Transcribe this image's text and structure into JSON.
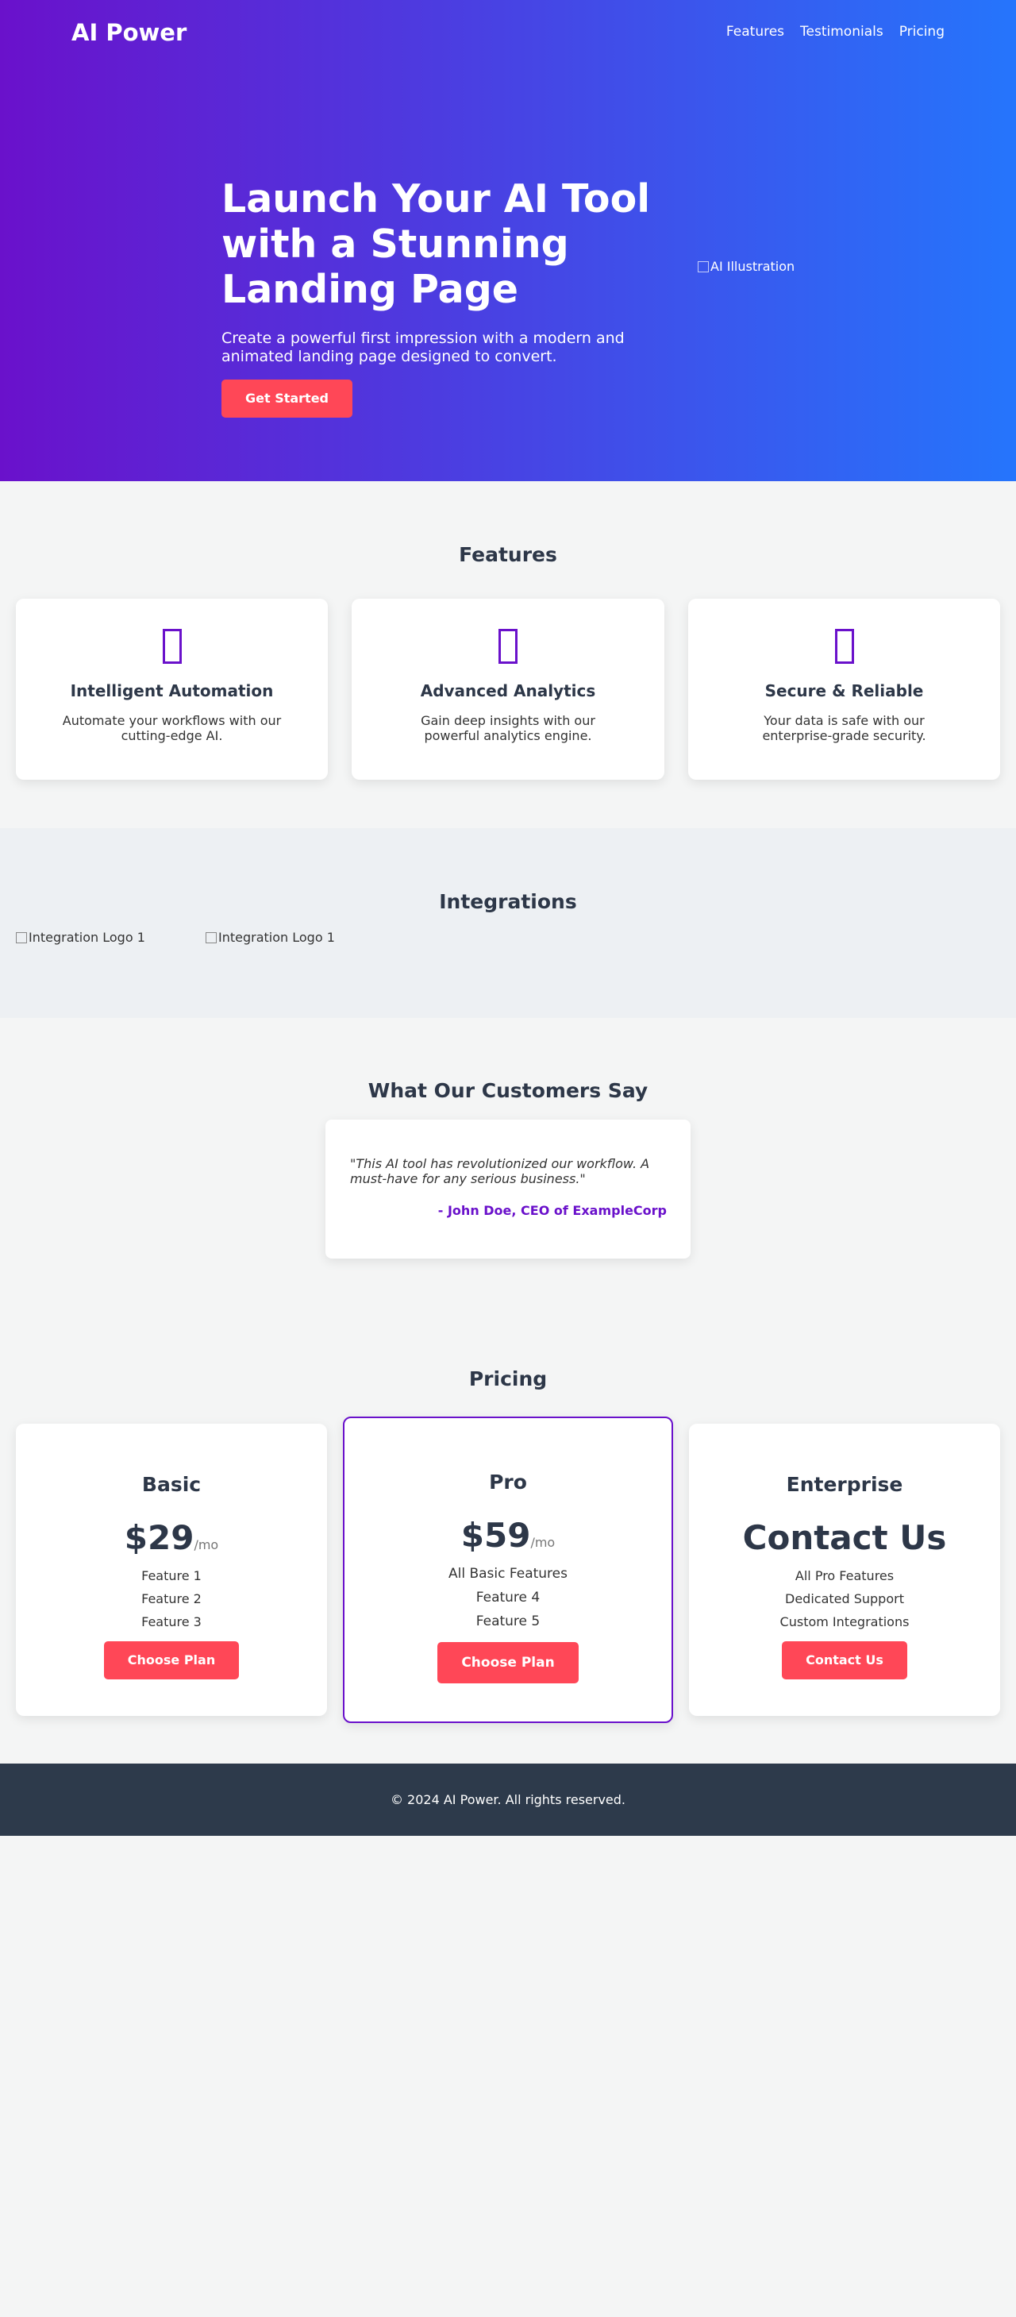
{
  "brand": "AI Power",
  "nav": [
    "Features",
    "Testimonials",
    "Pricing"
  ],
  "hero": {
    "title": "Launch Your AI Tool with a Stunning Landing Page",
    "subtitle": "Create a powerful first impression with a modern and animated landing page designed to convert.",
    "cta": "Get Started",
    "image_alt": "AI Illustration"
  },
  "features": {
    "title": "Features",
    "items": [
      {
        "icon": "robot-icon",
        "title": "Intelligent Automation",
        "desc": "Automate your workflows with our cutting-edge AI."
      },
      {
        "icon": "chart-icon",
        "title": "Advanced Analytics",
        "desc": "Gain deep insights with our powerful analytics engine."
      },
      {
        "icon": "shield-icon",
        "title": "Secure & Reliable",
        "desc": "Your data is safe with our enterprise-grade security."
      }
    ]
  },
  "integrations": {
    "title": "Integrations",
    "logos": [
      "Integration Logo 1",
      "Integration Logo 1"
    ]
  },
  "testimonials": {
    "title": "What Our Customers Say",
    "quote": "\"This AI tool has revolutionized our workflow. A must-have for any serious business.\"",
    "author": "- John Doe, CEO of ExampleCorp"
  },
  "pricing": {
    "title": "Pricing",
    "plans": [
      {
        "name": "Basic",
        "price": "$29",
        "per": "/mo",
        "features": [
          "Feature 1",
          "Feature 2",
          "Feature 3"
        ],
        "cta": "Choose Plan"
      },
      {
        "name": "Pro",
        "price": "$59",
        "per": "/mo",
        "features": [
          "All Basic Features",
          "Feature 4",
          "Feature 5"
        ],
        "cta": "Choose Plan",
        "highlight": true
      },
      {
        "name": "Enterprise",
        "price": "Contact Us",
        "per": "",
        "features": [
          "All Pro Features",
          "Dedicated Support",
          "Custom Integrations"
        ],
        "cta": "Contact Us"
      }
    ]
  },
  "footer": "© 2024 AI Power. All rights reserved.",
  "colors": {
    "gradient_start": "#6a11cb",
    "gradient_end": "#2575fc",
    "accent": "#ff4757",
    "dark": "#2d3748"
  }
}
